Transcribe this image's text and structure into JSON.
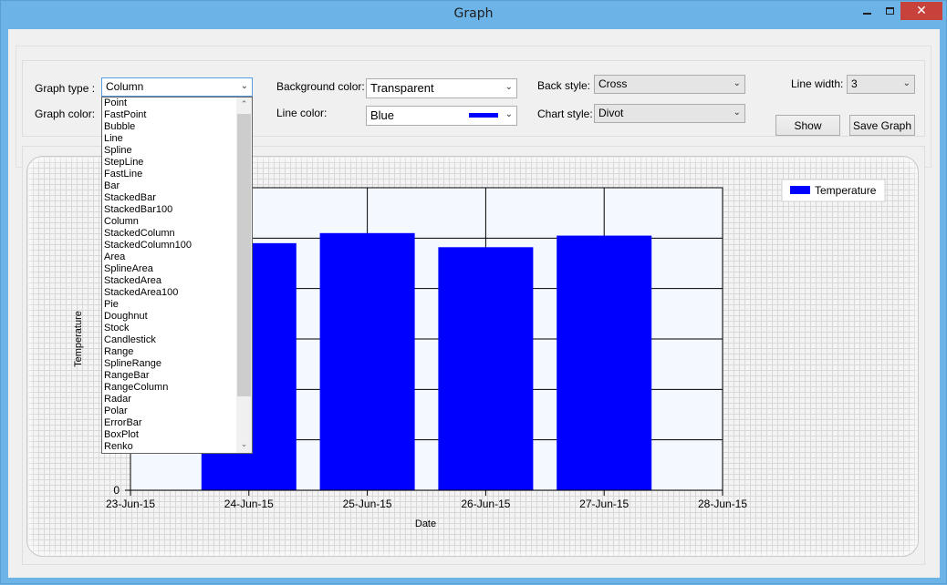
{
  "window": {
    "title": "Graph"
  },
  "controls": {
    "graph_type_label": "Graph type :",
    "graph_type_value": "Column",
    "graph_color_label": "Graph color:",
    "background_color_label": "Background color:",
    "background_color_value": "Transparent",
    "line_color_label": "Line color:",
    "line_color_value": "Blue",
    "line_color_swatch": "#0000ff",
    "back_style_label": "Back style:",
    "back_style_value": "Cross",
    "chart_style_label": "Chart style:",
    "chart_style_value": "Divot",
    "line_width_label": "Line width:",
    "line_width_value": "3",
    "show_button": "Show",
    "save_button": "Save Graph"
  },
  "graph_type_options": [
    "Point",
    "FastPoint",
    "Bubble",
    "Line",
    "Spline",
    "StepLine",
    "FastLine",
    "Bar",
    "StackedBar",
    "StackedBar100",
    "Column",
    "StackedColumn",
    "StackedColumn100",
    "Area",
    "SplineArea",
    "StackedArea",
    "StackedArea100",
    "Pie",
    "Doughnut",
    "Stock",
    "Candlestick",
    "Range",
    "SplineRange",
    "RangeBar",
    "RangeColumn",
    "Radar",
    "Polar",
    "ErrorBar",
    "BoxPlot",
    "Renko"
  ],
  "chart_data": {
    "type": "bar",
    "x": [
      "23-Jun-15",
      "24-Jun-15",
      "25-Jun-15",
      "26-Jun-15",
      "27-Jun-15",
      "28-Jun-15"
    ],
    "categories": [
      "24-Jun-15",
      "25-Jun-15",
      "26-Jun-15",
      "27-Jun-15"
    ],
    "series": [
      {
        "name": "Temperature",
        "values": [
          49,
          51,
          48.2,
          50.5
        ],
        "color": "#0000ff"
      }
    ],
    "xlabel": "Date",
    "ylabel": "Temperature",
    "ylim": [
      0,
      60
    ],
    "y_tick_labels": [
      "0"
    ],
    "legend_position": "top-right",
    "grid": true
  }
}
